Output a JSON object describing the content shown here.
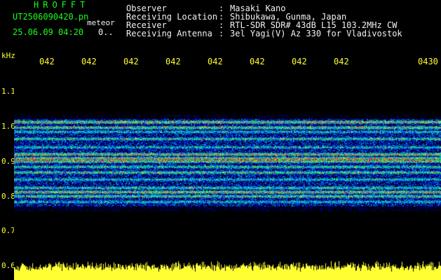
{
  "header": {
    "logo": "HROFFT",
    "filename": "UT2506090420.pn",
    "meteor_label": "meteor",
    "datetime": "25.06.09 04:20",
    "counter": "0.."
  },
  "info": [
    {
      "label": "Observer",
      "value": "Masaki Kano"
    },
    {
      "label": "Receiving Location",
      "value": "Shibukawa, Gunma, Japan"
    },
    {
      "label": "Receiver",
      "value": "RTL-SDR SDR# 43dB L15 103.2MHz CW"
    },
    {
      "label": "Receiving Antenna",
      "value": "3el Yagi(V) Az 330 for Vladivostok"
    }
  ],
  "info_separator": ":",
  "yaxis": {
    "unit": "kHz",
    "ticks": [
      "1.1",
      "1.0",
      "0.9",
      "0.8",
      "0.7",
      "0.6"
    ]
  },
  "xaxis": {
    "ticks": [
      "042",
      "042",
      "042",
      "042",
      "042",
      "042",
      "042",
      "042",
      "0430"
    ]
  },
  "colors": {
    "label_green": "#19ff19",
    "tick_yellow": "#ffff33",
    "text_white": "#f2f2f2",
    "background": "#000000"
  }
}
